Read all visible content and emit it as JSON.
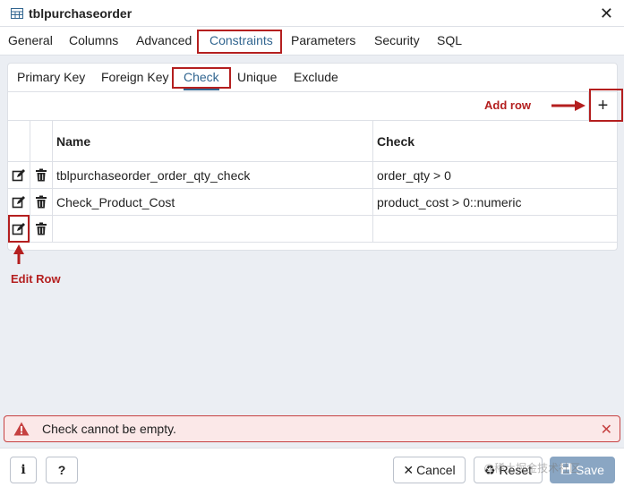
{
  "window": {
    "title": "tblpurchaseorder",
    "icon": "table-icon"
  },
  "main_tabs": [
    {
      "label": "General"
    },
    {
      "label": "Columns"
    },
    {
      "label": "Advanced"
    },
    {
      "label": "Constraints",
      "active": true
    },
    {
      "label": "Parameters"
    },
    {
      "label": "Security"
    },
    {
      "label": "SQL"
    }
  ],
  "sub_tabs": [
    {
      "label": "Primary Key"
    },
    {
      "label": "Foreign Key"
    },
    {
      "label": "Check",
      "active": true
    },
    {
      "label": "Unique"
    },
    {
      "label": "Exclude"
    }
  ],
  "grid": {
    "headers": {
      "name": "Name",
      "check": "Check"
    },
    "rows": [
      {
        "name": "tblpurchaseorder_order_qty_check",
        "check": "order_qty > 0"
      },
      {
        "name": "Check_Product_Cost",
        "check": "product_cost > 0::numeric"
      },
      {
        "name": "",
        "check": ""
      }
    ]
  },
  "annotations": {
    "add_row": "Add row",
    "edit_row": "Edit Row"
  },
  "error": {
    "message": "Check cannot be empty."
  },
  "footer": {
    "info_label": "i",
    "help_label": "?",
    "cancel_label": "Cancel",
    "reset_label": "Reset",
    "save_label": "Save"
  },
  "watermark": "@稀土掘金技术社区",
  "colors": {
    "accent": "#326690",
    "annotation": "#b41f1f",
    "error": "#c64141",
    "save": "#8aa6c3"
  }
}
